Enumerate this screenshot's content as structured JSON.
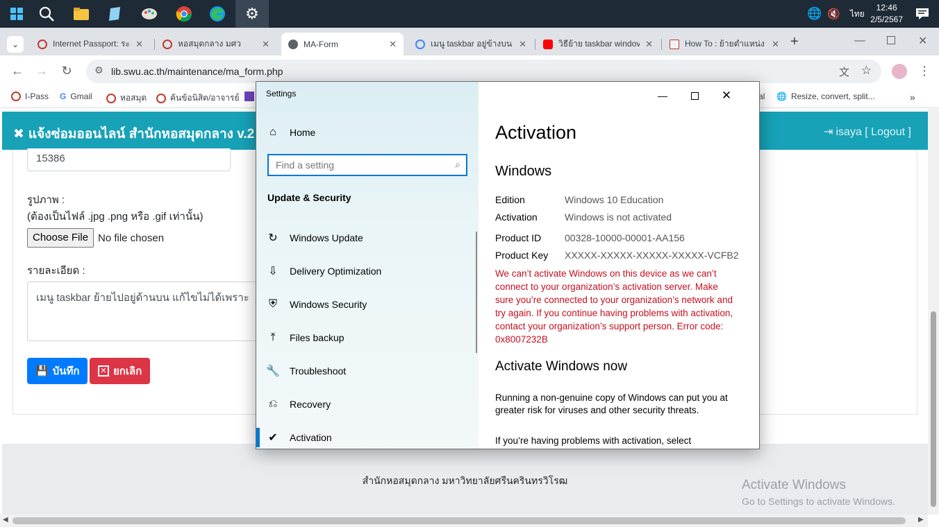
{
  "taskbar": {
    "tray_lang": "ไทย",
    "clock_time": "12:46",
    "clock_date": "2/5/2567"
  },
  "tabs": [
    {
      "title": "Internet Passport: ระบ",
      "color": "#c0392b"
    },
    {
      "title": "หอสมุดกลาง มศว",
      "color": "#c0392b"
    },
    {
      "title": "MA-Form",
      "color": "#5f6368"
    },
    {
      "title": "เมนู taskbar อยู่ข้างบน",
      "color": "#4285f4"
    },
    {
      "title": "วิธีย้าย taskbar windov",
      "color": "#ff0000"
    },
    {
      "title": "How To : ย้ายตำแหน่ง",
      "color": "#c0392b"
    }
  ],
  "address": {
    "url": "lib.swu.ac.th/maintenance/ma_form.php"
  },
  "bookmarks": [
    "I-Pass",
    "Gmail",
    "หอสมุด",
    "ค้นข้อนิสิต/อาจารย์",
    "al",
    "Resize, convert, split..."
  ],
  "site": {
    "brand": "แจ้งซ่อมออนไลน์ สำนักหอสมุดกลาง v.2",
    "user": "isaya [ Logout ]",
    "id_value": "15386",
    "image_label": "รูปภาพ :",
    "image_hint": "(ต้องเป็นไฟล์ .jpg .png หรือ .gif เท่านั้น)",
    "choose_file": "Choose File",
    "no_file": "No file chosen",
    "detail_label": "รายละเอียด :",
    "detail_value": "เมนู taskbar ย้ายไปอยู่ด้านบน แก้ไขไม่ได้เพราะ",
    "save_label": "บันทึก",
    "cancel_label": "ยกเลิก",
    "footer": "สำนักหอสมุดกลาง มหาวิทยาลัยศรีนครินทรวิโรฒ"
  },
  "watermark": {
    "line1": "Activate Windows",
    "line2": "Go to Settings to activate Windows."
  },
  "settings": {
    "title": "Settings",
    "home": "Home",
    "search_placeholder": "Find a setting",
    "section": "Update & Security",
    "nav": [
      {
        "label": "Windows Update",
        "icon": "refresh-icon"
      },
      {
        "label": "Delivery Optimization",
        "icon": "delivery-icon"
      },
      {
        "label": "Windows Security",
        "icon": "shield-icon"
      },
      {
        "label": "Files backup",
        "icon": "upload-icon"
      },
      {
        "label": "Troubleshoot",
        "icon": "wrench-icon"
      },
      {
        "label": "Recovery",
        "icon": "recovery-icon"
      },
      {
        "label": "Activation",
        "icon": "check-circle-icon",
        "selected": true
      }
    ],
    "heading": "Activation",
    "windows_heading": "Windows",
    "edition_label": "Edition",
    "edition_value": "Windows 10 Education",
    "activation_label": "Activation",
    "activation_value": "Windows is not activated",
    "product_id_label": "Product ID",
    "product_id_value": "00328-10000-00001-AA156",
    "product_key_label": "Product Key",
    "product_key_value": "XXXXX-XXXXX-XXXXX-XXXXX-VCFB2",
    "error_text": "We can’t activate Windows on this device as we can’t connect to your organization’s activation server. Make sure you’re connected to your organization’s network and try again. If you continue having problems with activation, contact your organization’s support person. Error code: 0x8007232B",
    "activate_now_heading": "Activate Windows now",
    "para1": "Running a non-genuine copy of Windows can put you at greater risk for viruses and other security threats.",
    "para2": "If you’re having problems with activation, select"
  }
}
